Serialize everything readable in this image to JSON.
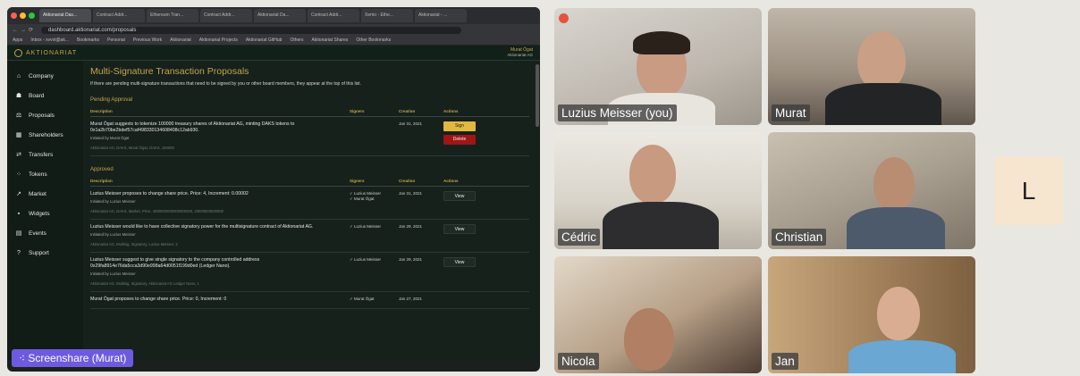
{
  "browser": {
    "tabs": [
      "Aktionariat Das...",
      "Contract Addr...",
      "Ethereum Tran...",
      "Contract Addr...",
      "Aktionariat Da...",
      "Contract Addr...",
      "Xemo - Ethe...",
      "Aktionariat - ..."
    ],
    "url": "dashboard.aktionariat.com/proposals",
    "bookmarks": [
      "Apps",
      "Inbox - xvvvt@ak...",
      "Bookmarks",
      "Personal",
      "Previous Work",
      "Aktionariat",
      "Aktionariat Projects",
      "Aktionariat GitHub",
      "Others",
      "Aktionariat Shares",
      "Other Bookmarks"
    ]
  },
  "app": {
    "brand": "AKTIONARIAT",
    "user_name": "Murat Ögat",
    "user_company": "Aktionariat AG"
  },
  "sidebar": {
    "items": [
      {
        "label": "Company",
        "icon": "home-icon"
      },
      {
        "label": "Board",
        "icon": "people-icon"
      },
      {
        "label": "Proposals",
        "icon": "gavel-icon"
      },
      {
        "label": "Shareholders",
        "icon": "table-icon"
      },
      {
        "label": "Transfers",
        "icon": "transfer-icon"
      },
      {
        "label": "Tokens",
        "icon": "token-icon"
      },
      {
        "label": "Market",
        "icon": "chart-icon"
      },
      {
        "label": "Widgets",
        "icon": "widgets-icon"
      },
      {
        "label": "Events",
        "icon": "events-icon"
      },
      {
        "label": "Support",
        "icon": "help-icon"
      }
    ]
  },
  "main": {
    "title": "Multi-Signature Transaction Proposals",
    "intro": "If there are pending multi-signature transactions that need to be signed by you or other board members, they appear at the top of this list.",
    "columns": {
      "description": "Description",
      "signers": "Signers",
      "creation": "Creation",
      "actions": "Actions"
    },
    "pending": {
      "heading": "Pending Approval",
      "rows": [
        {
          "desc": "Murat Ögat suggests to tokenize 100000 treasury shares of Aktionariat AG, minting DAKS tokens to 0x1a2b70be2bdef57caf498330134608408c12ab930.",
          "by": "Initiated by Murat Ögat",
          "meta": "Aktionariat AG, DAKS, Murat Ögat, DAKS, 100000",
          "signers": "",
          "date": "Jan 31, 2021",
          "sign": "Sign",
          "delete": "Delete"
        }
      ]
    },
    "approved": {
      "heading": "Approved",
      "rows": [
        {
          "desc": "Luzius Meisser proposes to change share price. Price: 4, Increment: 0.00002",
          "by": "Initiated by Luzius Meisser",
          "meta": "Aktionariat AG, DAKS, Market, Price, 4000000000000000000, 20000000000000",
          "signers": "✓ Luzius Meisser\n✓ Murat Ögat",
          "date": "Jan 31, 2021",
          "view": "View"
        },
        {
          "desc": "Luzius Meisser would like to have collective signatory power for the multisignature contract of Aktionariat AG.",
          "by": "Initiated by Luzius Meisser",
          "meta": "Aktionariat AG, Multisig, Signatory, Luzius Meisser, 2",
          "signers": "✓ Luzius Meisser",
          "date": "Jan 29, 2021",
          "view": "View"
        },
        {
          "desc": "Luzius Meisser suggest to give single signatory to the company controlled address 0x29fa8914e76da5cca3d90e998a64d0051f199d0ed (Ledger Nano).",
          "by": "Initiated by Luzius Meisser",
          "meta": "Aktionariat AG, Multisig, Signatory, Aktionariat AG Ledger Nano, 1",
          "signers": "✓ Luzius Meisser",
          "date": "Jan 29, 2021",
          "view": "View"
        },
        {
          "desc": "Murat Ögat proposes to change share price. Price: 0, Increment: 0",
          "by": "",
          "meta": "",
          "signers": "✓ Murat Ögat",
          "date": "Jan 27, 2021",
          "view": ""
        }
      ]
    }
  },
  "share_label": "Screenshare (Murat)",
  "participants": [
    {
      "name": "Luzius Meisser (you)"
    },
    {
      "name": "Murat"
    },
    {
      "name": "Cédric"
    },
    {
      "name": "Christian"
    },
    {
      "name": "Nicola"
    },
    {
      "name": "Jan"
    }
  ],
  "extra_participant_initial": "L",
  "colors": {
    "accent_gold": "#c7a548",
    "sign_button": "#e2b93f",
    "delete_button": "#9e1616",
    "share_label": "#6d5ae0",
    "recording": "#e5533d"
  }
}
